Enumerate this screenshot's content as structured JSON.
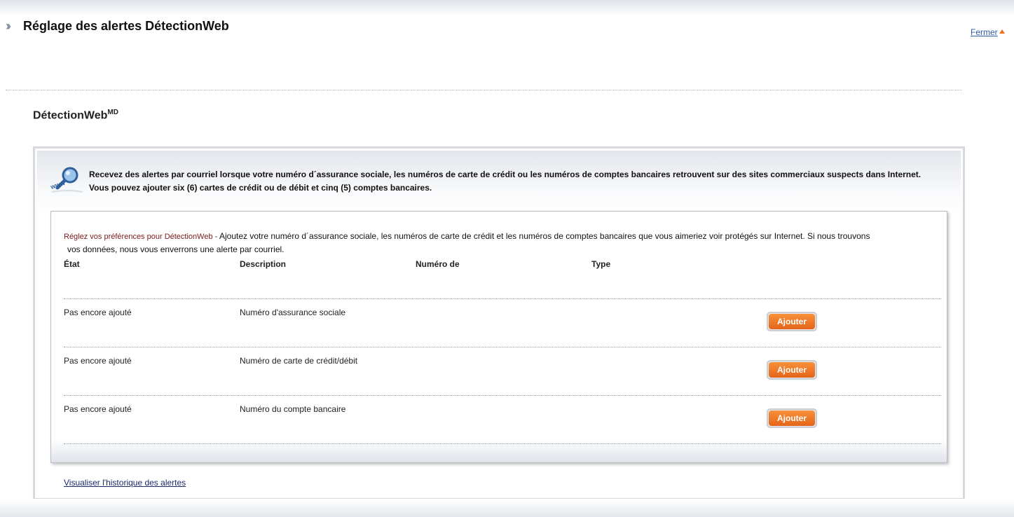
{
  "header": {
    "title": "Réglage des alertes DétectionWeb",
    "close_label": "Fermer"
  },
  "section": {
    "title": "DétectionWeb",
    "title_sup": "MD"
  },
  "info": {
    "icon": "magnifier-www-icon",
    "line1": "Recevez des alertes par courriel lorsque votre numéro d´assurance sociale, les numéros de carte de crédit ou les numéros de comptes bancaires retrouvent sur des sites commerciaux suspects dans Internet.",
    "line2": "Vous pouvez ajouter six (6) cartes de crédit ou de débit et cinq (5) comptes bancaires."
  },
  "preferences": {
    "label": "Réglez vos préférences pour DétectionWeb -",
    "text": "Ajoutez votre numéro d´assurance sociale, les numéros de carte de crédit et les numéros de comptes bancaires que vous aimeriez voir protégés sur Internet. Si nous trouvons",
    "text2": "vos données, nous vous enverrons une alerte par courriel."
  },
  "table": {
    "headers": {
      "status": "État",
      "description": "Description",
      "number": "Numéro de",
      "type": "Type"
    },
    "rows": [
      {
        "status": "Pas encore ajouté",
        "description": "Numéro d'assurance sociale",
        "button": "Ajouter"
      },
      {
        "status": "Pas encore ajouté",
        "description": "Numéro de carte de crédit/débit",
        "button": "Ajouter"
      },
      {
        "status": "Pas encore ajouté",
        "description": "Numéro du compte bancaire",
        "button": "Ajouter"
      }
    ]
  },
  "footer": {
    "history_link": "Visualiser l'historique des alertes"
  },
  "colors": {
    "accent_orange": "#e8731e",
    "link_blue": "#2a5aa0",
    "pref_label": "#7a1a1a"
  }
}
